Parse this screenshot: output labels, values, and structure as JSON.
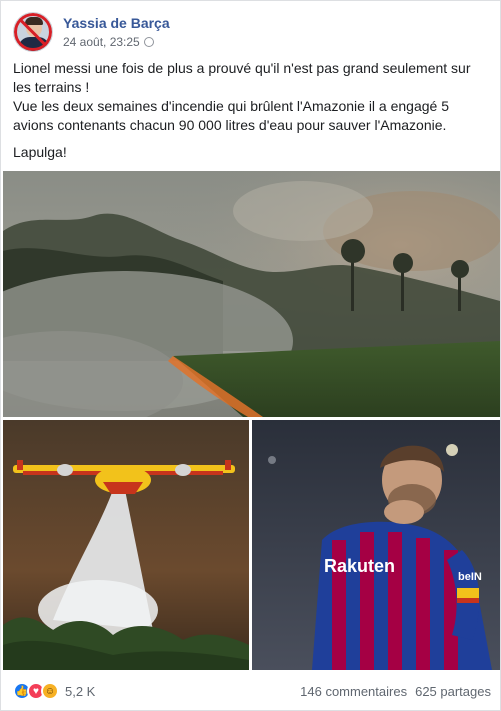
{
  "post": {
    "author": "Yassia de Barça",
    "timestamp": "24 août, 23:25",
    "text_line1": "Lionel messi une fois de plus a prouvé qu'il n'est pas grand seulement sur les terrains !",
    "text_line2": "Vue les deux semaines d'incendie qui brûlent l'Amazonie il a engagé 5 avions contenants chacun 90 000 litres d'eau pour sauver l'Amazonie.",
    "text_line3": "Lapulga!",
    "jersey_text": "Rakuten",
    "sleeve_text": "beIN"
  },
  "reactions": {
    "icons": [
      "like-icon",
      "love-icon",
      "haha-icon"
    ],
    "count": "5,2 K"
  },
  "stats": {
    "comments": "146 commentaires",
    "shares": "625 partages"
  },
  "colors": {
    "author_link": "#385898",
    "like": "#1877f2",
    "love": "#f33e58",
    "haha": "#f7b125"
  }
}
